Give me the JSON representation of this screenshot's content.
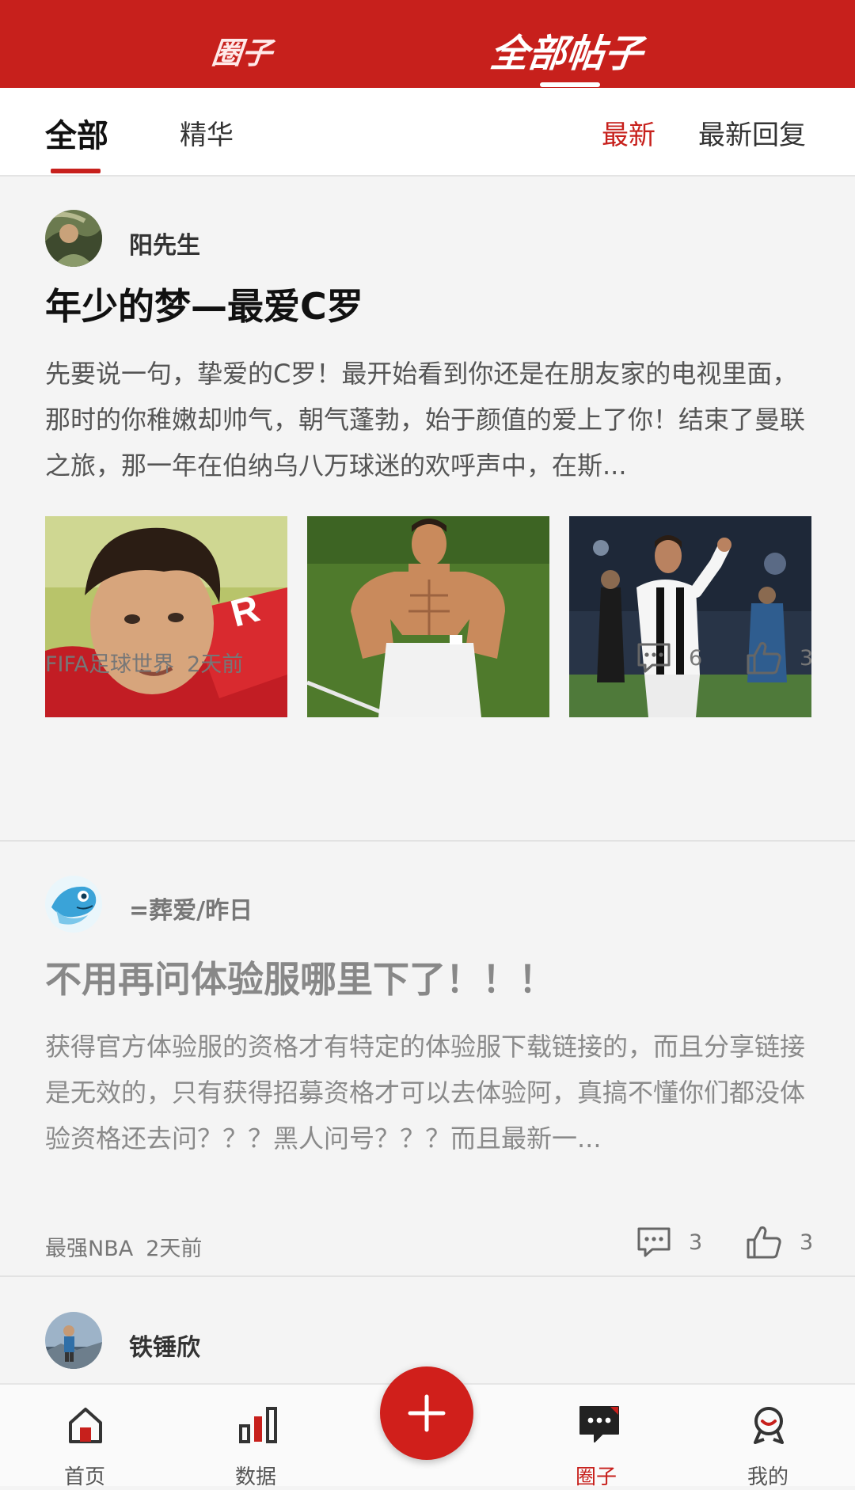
{
  "header": {
    "tabs": [
      {
        "label": "圈子",
        "active": false
      },
      {
        "label": "全部帖子",
        "active": true
      }
    ]
  },
  "subtabs": {
    "filters": [
      "全部",
      "精华"
    ],
    "active_filter": "全部",
    "sorts": [
      "最新",
      "最新回复"
    ],
    "active_sort": "最新"
  },
  "posts": [
    {
      "author": "阳先生",
      "title": "年少的梦—最爱C罗",
      "body": "先要说一句，挚爱的C罗！最开始看到你还是在朋友家的电视里面，那时的你稚嫩却帅气，朝气蓬勃，始于颜值的爱上了你！结束了曼联之旅，那一年在伯纳乌八万球迷的欢呼声中，在斯...",
      "images": [
        "player-portrait-red-jersey",
        "player-shirtless-celebration",
        "player-clapping-striped-jersey"
      ],
      "forum": "FIFA足球世界",
      "time": "2天前",
      "comments": "6",
      "likes": "3"
    },
    {
      "author": "=葬爱/昨日",
      "title": "不用再问体验服哪里下了！！！",
      "body": "获得官方体验服的资格才有特定的体验服下载链接的，而且分享链接是无效的，只有获得招募资格才可以去体验阿，真搞不懂你们都没体验资格还去问？？？黑人问号？？？而且最新一...",
      "forum": "最强NBA",
      "time": "2天前",
      "comments": "3",
      "likes": "3"
    },
    {
      "author": "铁锤欣"
    }
  ],
  "bottom_nav": [
    {
      "label": "首页",
      "icon": "home-icon",
      "active": false
    },
    {
      "label": "数据",
      "icon": "bar-chart-icon",
      "active": false
    },
    {
      "label": "圈子",
      "icon": "chat-bubble-icon",
      "active": true
    },
    {
      "label": "我的",
      "icon": "profile-badge-icon",
      "active": false
    }
  ],
  "fab": {
    "icon": "plus-icon"
  },
  "colors": {
    "accent": "#c7201c",
    "background": "#f4f4f4",
    "text_muted": "#777777"
  }
}
